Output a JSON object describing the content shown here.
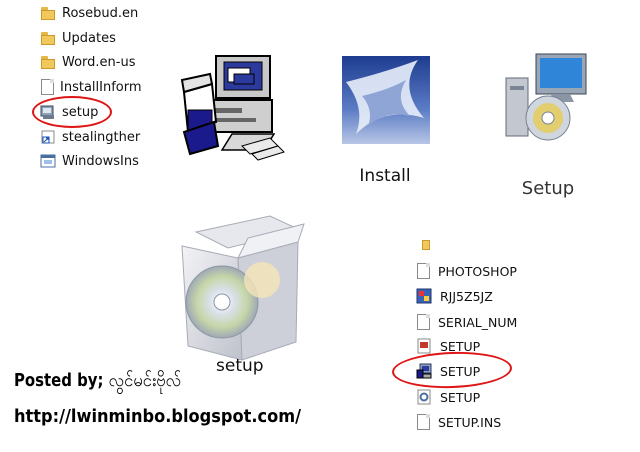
{
  "explorer_top": {
    "items": [
      {
        "label": "Rosebud.en",
        "icon": "folder-icon"
      },
      {
        "label": "Updates",
        "icon": "folder-icon"
      },
      {
        "label": "Word.en-us",
        "icon": "folder-icon"
      },
      {
        "label": "InstallInform",
        "icon": "document-icon"
      },
      {
        "label": "setup",
        "icon": "installer-icon"
      },
      {
        "label": "stealingther",
        "icon": "shortcut-icon"
      },
      {
        "label": "WindowsIns",
        "icon": "window-icon"
      }
    ]
  },
  "tiles": {
    "install_label": "Install",
    "setup_label": "Setup",
    "setup_box_label": "setup"
  },
  "explorer_bottom": {
    "items": [
      {
        "label": "PHOTOSHOP",
        "icon": "document-icon"
      },
      {
        "label": "RJJ5Z5JZ",
        "icon": "app-icon"
      },
      {
        "label": "SERIAL_NUM",
        "icon": "document-icon"
      },
      {
        "label": "SETUP",
        "icon": "setup-doc-icon"
      },
      {
        "label": "SETUP",
        "icon": "installer-icon"
      },
      {
        "label": "SETUP",
        "icon": "gear-doc-icon"
      },
      {
        "label": "SETUP.INS",
        "icon": "document-icon"
      }
    ]
  },
  "footer": {
    "posted_by": "Posted by;",
    "author": "လွင်မင်းဗိုလ်",
    "url": "http://lwinminbo.blogspot.com/"
  },
  "colors": {
    "highlight": "#e01515",
    "folder": "#f2c85c"
  }
}
